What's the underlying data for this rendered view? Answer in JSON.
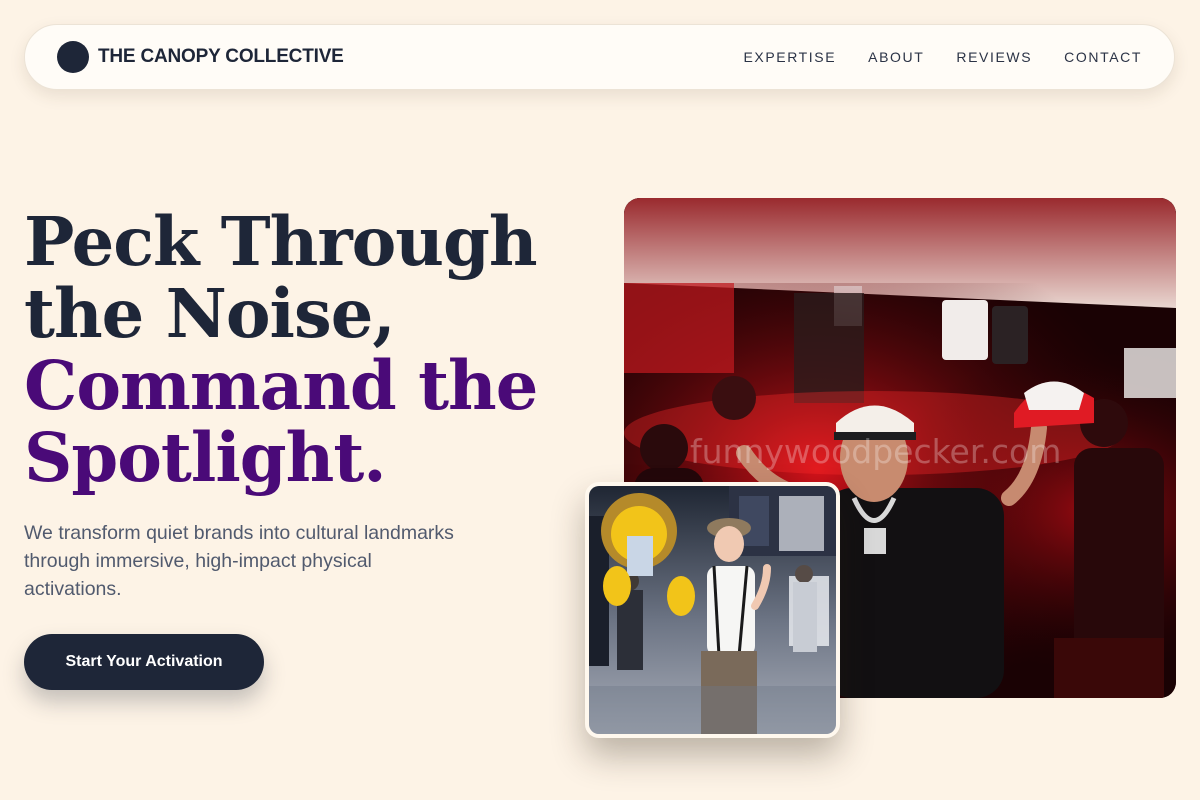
{
  "header": {
    "brand": "THE CANOPY COLLECTIVE",
    "nav": [
      "EXPERTISE",
      "ABOUT",
      "REVIEWS",
      "CONTACT"
    ]
  },
  "hero": {
    "title_lines": [
      "Peck Through",
      "the Noise,"
    ],
    "accent_lines": [
      "Command the",
      "Spotlight."
    ],
    "subtitle": "We transform quiet brands into cultural landmarks through immersive, high-impact physical activations.",
    "cta_label": "Start Your Activation"
  },
  "photos": {
    "main_watermark": "funnywoodpecker.com"
  },
  "colors": {
    "background": "#fdf3e6",
    "navy": "#1e2638",
    "accent_purple": "#4a0a78",
    "body_text": "#515a6e"
  },
  "icons": {
    "logo": "circle-logo-icon"
  }
}
